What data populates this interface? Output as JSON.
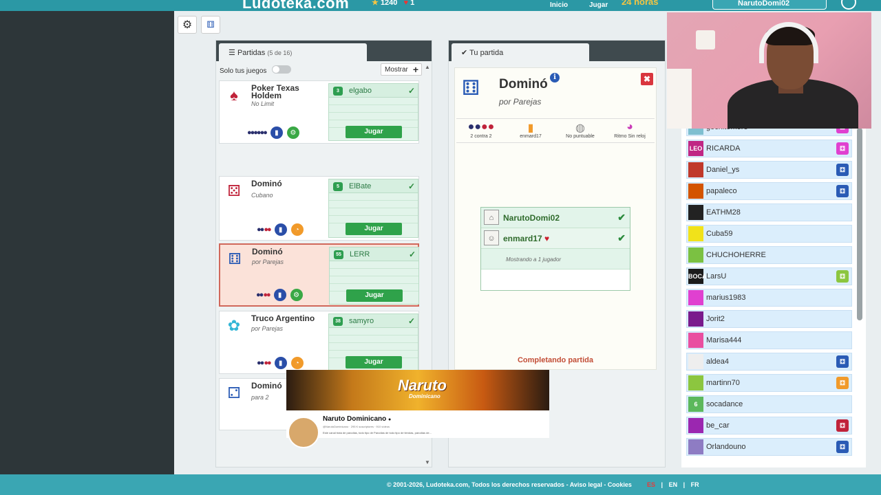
{
  "topbar": {
    "logo": "Ludoteka.com",
    "points": "1240",
    "hearts": "1",
    "nav_inicio": "Inicio",
    "nav_jugar": "Jugar",
    "hours": "24 horas",
    "user": "NarutoDomi02"
  },
  "games_panel": {
    "title": "Partidas",
    "count": "(5 de 16)",
    "filter_label": "Solo tus juegos",
    "show_label": "Mostrar",
    "jugar": "Jugar",
    "games": [
      {
        "name": "Poker Texas Holdem",
        "sub": "No Limit",
        "seat_player": "elgabo",
        "seat_level": "3"
      },
      {
        "name": "Dominó",
        "sub": "Cubano",
        "seat_player": "ElBate",
        "seat_level": "5"
      },
      {
        "name": "Dominó",
        "sub": "por Parejas",
        "seat_player": "LERR",
        "seat_level": "55"
      },
      {
        "name": "Truco Argentino",
        "sub": "por Parejas",
        "seat_player": "samyro",
        "seat_level": "38"
      },
      {
        "name": "Dominó",
        "sub": "para 2"
      }
    ]
  },
  "match_panel": {
    "tab_title": "Tu partida",
    "game_title": "Dominó",
    "game_sub": "por Parejas",
    "options": [
      "2 contra 2",
      "enmard17",
      "No puntuable",
      "Ritmo Sin reloj"
    ],
    "players": [
      {
        "name": "NarutoDomi02"
      },
      {
        "name": "enmard17"
      }
    ],
    "showing": "Mostrando a 1 jugador",
    "status": "Completando partida"
  },
  "user_list": [
    {
      "name": "gochitomore",
      "avatar_color": "#7fbfd0",
      "avatar_text": ""
    },
    {
      "name": "RICARDA",
      "avatar_color": "#c02784",
      "avatar_text": "LEO"
    },
    {
      "name": "Daniel_ys",
      "avatar_color": "#c0392b",
      "avatar_text": ""
    },
    {
      "name": "papaleco",
      "avatar_color": "#d35400",
      "avatar_text": ""
    },
    {
      "name": "EATHM28",
      "avatar_color": "#222222",
      "avatar_text": ""
    },
    {
      "name": "Cuba59",
      "avatar_color": "#f1e21a",
      "avatar_text": ""
    },
    {
      "name": "CHUCHOHERRE",
      "avatar_color": "#7bc142",
      "avatar_text": ""
    },
    {
      "name": "LarsU",
      "avatar_color": "#1b1b1b",
      "avatar_text": "BOCA"
    },
    {
      "name": "marius1983",
      "avatar_color": "#e040d0",
      "avatar_text": ""
    },
    {
      "name": "Jorit2",
      "avatar_color": "#7a1b8c",
      "avatar_text": ""
    },
    {
      "name": "Marisa444",
      "avatar_color": "#e94fa0",
      "avatar_text": ""
    },
    {
      "name": "aldea4",
      "avatar_color": "#eeeeee",
      "avatar_text": ""
    },
    {
      "name": "martinn70",
      "avatar_color": "#8cc63f",
      "avatar_text": ""
    },
    {
      "name": "socadance",
      "avatar_color": "#5cb85c",
      "avatar_text": "6"
    },
    {
      "name": "be_car",
      "avatar_color": "#9b27b0",
      "avatar_text": ""
    },
    {
      "name": "Orlandouno",
      "avatar_color": "#8e7cc3",
      "avatar_text": ""
    }
  ],
  "banner": {
    "title": "Naruto",
    "subtitle": "Dominicano",
    "channel_name": "Naruto Dominicano",
    "handle": "@NarutoDominicano · 295 K suscriptores · 910 vídeos",
    "description": "Este canal trata de parodias, todo tipo de Parodias de todo tipo de tiendas, parodias de..."
  },
  "footer": {
    "copyright": "© 2001-2026, Ludoteka.com, Todos los derechos reservados - Aviso legal - Cookies",
    "lang_es": "ES",
    "lang_en": "EN",
    "lang_fr": "FR"
  }
}
